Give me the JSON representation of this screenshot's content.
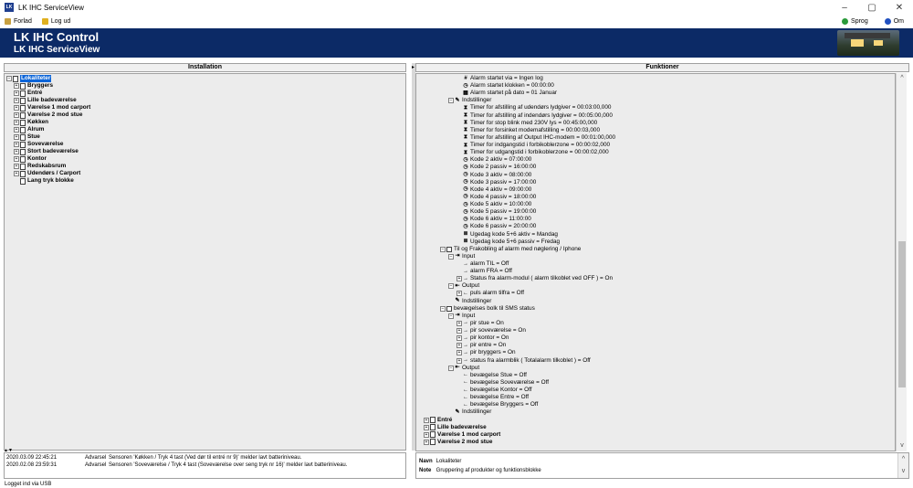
{
  "window": {
    "title": "LK IHC ServiceView",
    "logo_text": "LK",
    "minimize": "–",
    "maximize": "▢",
    "close": "✕"
  },
  "menu": {
    "leave": "Forlad",
    "logout": "Log ud",
    "language": "Sprog",
    "about": "Om"
  },
  "banner": {
    "title": "LK IHC Control",
    "subtitle": "LK IHC ServiceView"
  },
  "installation": {
    "header": "Installation",
    "items": [
      {
        "label": "Lokaliteter",
        "selected": true
      },
      {
        "label": "Bryggers"
      },
      {
        "label": "Entré"
      },
      {
        "label": "Lille badeværelse"
      },
      {
        "label": "Værelse 1 mod carport"
      },
      {
        "label": "Værelse 2 mod stue"
      },
      {
        "label": "Køkken"
      },
      {
        "label": "Alrum"
      },
      {
        "label": "Stue"
      },
      {
        "label": "Soveværelse"
      },
      {
        "label": "Stort badeværelse"
      },
      {
        "label": "Kontor"
      },
      {
        "label": "Redskabsrum"
      },
      {
        "label": "Udendørs / Carport"
      },
      {
        "label": "Lang tryk blokke"
      }
    ]
  },
  "functions": {
    "header": "Funktioner",
    "rows": [
      {
        "indent": 4,
        "icon": "hash",
        "label": "Alarm startet via = Ingen log"
      },
      {
        "indent": 4,
        "icon": "clock",
        "label": "Alarm startet klokken = 00:00:00"
      },
      {
        "indent": 4,
        "icon": "calendar",
        "label": "Alarm startet på dato = 01 Januar"
      },
      {
        "indent": 3,
        "exp": "−",
        "icon": "settings",
        "label": "Indstillinger"
      },
      {
        "indent": 4,
        "icon": "hourglass",
        "label": "Timer for afstilling af udendørs lydgiver = 00:03:00,000"
      },
      {
        "indent": 4,
        "icon": "hourglass",
        "label": "Timer for afstilling af indendørs lydgiver = 00:05:00,000"
      },
      {
        "indent": 4,
        "icon": "hourglass",
        "label": "Timer for stop blink med 230V lys = 00:45:00,000"
      },
      {
        "indent": 4,
        "icon": "hourglass",
        "label": "Timer for forsinket modemafstilling = 00:00:03,000"
      },
      {
        "indent": 4,
        "icon": "hourglass",
        "label": "Timer for afstilling af Output IHC-modem = 00:01:00,000"
      },
      {
        "indent": 4,
        "icon": "hourglass",
        "label": "Timer for indgangstid i forbikoblerzone = 00:00:02,000"
      },
      {
        "indent": 4,
        "icon": "hourglass",
        "label": "Timer for udgangstid i forbikoblerzone = 00:00:02,000"
      },
      {
        "indent": 4,
        "icon": "clock",
        "label": "Kode 2 aktiv = 07:00:00"
      },
      {
        "indent": 4,
        "icon": "clock",
        "label": "Kode 2 passiv = 16:00:00"
      },
      {
        "indent": 4,
        "icon": "clock",
        "label": "Kode 3 aktiv = 08:00:00"
      },
      {
        "indent": 4,
        "icon": "clock",
        "label": "Kode 3 passiv = 17:00:00"
      },
      {
        "indent": 4,
        "icon": "clock",
        "label": "Kode 4 aktiv = 09:00:00"
      },
      {
        "indent": 4,
        "icon": "clock",
        "label": "Kode 4 passiv = 18:00:00"
      },
      {
        "indent": 4,
        "icon": "clock",
        "label": "Kode 5 aktiv = 10:00:00"
      },
      {
        "indent": 4,
        "icon": "clock",
        "label": "Kode 5 passiv = 19:00:00"
      },
      {
        "indent": 4,
        "icon": "clock",
        "label": "Kode 6 aktiv = 11:00:00"
      },
      {
        "indent": 4,
        "icon": "clock",
        "label": "Kode 6 passiv = 20:00:00"
      },
      {
        "indent": 4,
        "icon": "weekday",
        "label": "Ugedag kode 5+6 aktiv = Mandag"
      },
      {
        "indent": 4,
        "icon": "weekday",
        "label": "Ugedag kode 5+6 passiv = Fredag"
      },
      {
        "indent": 2,
        "exp": "−",
        "icon": "block",
        "label": "Til og Frakobling af alarm med nøglering / Iphone"
      },
      {
        "indent": 3,
        "exp": "−",
        "icon": "input",
        "label": "Input"
      },
      {
        "indent": 4,
        "icon": "arrow-right",
        "label": "alarm TIL = Off"
      },
      {
        "indent": 4,
        "icon": "arrow-right",
        "label": "alarm FRA = Off"
      },
      {
        "indent": 4,
        "exp": "+",
        "icon": "arrow-right",
        "label": "Status fra alarm-modul ( alarm tilkoblet ved OFF ) = On"
      },
      {
        "indent": 3,
        "exp": "−",
        "icon": "output",
        "label": "Output"
      },
      {
        "indent": 4,
        "exp": "+",
        "icon": "arrow-left",
        "label": "puls alarm tilfra = Off"
      },
      {
        "indent": 3,
        "icon": "settings",
        "label": "Indstillinger"
      },
      {
        "indent": 2,
        "exp": "−",
        "icon": "block",
        "label": "bevægelses bolk til SMS status"
      },
      {
        "indent": 3,
        "exp": "−",
        "icon": "input",
        "label": "Input"
      },
      {
        "indent": 4,
        "exp": "+",
        "icon": "arrow-right",
        "label": "pir stue = On"
      },
      {
        "indent": 4,
        "exp": "+",
        "icon": "arrow-right",
        "label": "pir soveværelse = On"
      },
      {
        "indent": 4,
        "exp": "+",
        "icon": "arrow-right",
        "label": "pir kontor = On"
      },
      {
        "indent": 4,
        "exp": "+",
        "icon": "arrow-right",
        "label": "pir entre = On"
      },
      {
        "indent": 4,
        "exp": "+",
        "icon": "arrow-right",
        "label": "pir bryggers = On"
      },
      {
        "indent": 4,
        "exp": "+",
        "icon": "arrow-right",
        "label": "status fra alarmblik ( Totalalarm tilkoblet ) = Off"
      },
      {
        "indent": 3,
        "exp": "−",
        "icon": "output",
        "label": "Output"
      },
      {
        "indent": 4,
        "icon": "arrow-left",
        "label": "bevægelse  Stue = Off"
      },
      {
        "indent": 4,
        "icon": "arrow-left",
        "label": "bevægelse  Soveværelse = Off"
      },
      {
        "indent": 4,
        "icon": "arrow-left",
        "label": "bevægelse  Kontor = Off"
      },
      {
        "indent": 4,
        "icon": "arrow-left",
        "label": "bevægelse  Entre = Off"
      },
      {
        "indent": 4,
        "icon": "arrow-left",
        "label": "bevægelse  Bryggers = Off"
      },
      {
        "indent": 3,
        "icon": "settings",
        "label": "Indstillinger"
      },
      {
        "indent": 0,
        "exp": "+",
        "icon": "doc",
        "label": "Entré",
        "bold": true
      },
      {
        "indent": 0,
        "exp": "+",
        "icon": "doc",
        "label": "Lille badeværelse",
        "bold": true
      },
      {
        "indent": 0,
        "exp": "+",
        "icon": "doc",
        "label": "Værelse 1 mod carport",
        "bold": true
      },
      {
        "indent": 0,
        "exp": "+",
        "icon": "doc",
        "label": "Værelse 2 mod stue",
        "bold": true
      }
    ]
  },
  "log": {
    "sort_indicator": "▲▼",
    "entries": [
      {
        "time": "2020.03.09 22:45:21",
        "level": "Advarsel",
        "message": "Sensoren 'Køkken / Tryk 4 tast (Ved dør til entré nr 9)' melder lavt batteriniveau."
      },
      {
        "time": "2020.02.08 23:59:31",
        "level": "Advarsel",
        "message": "Sensoren 'Soveværelse / Tryk 4 tast (Soveværelse over seng tryk nr 16)' melder lavt batteriniveau."
      }
    ]
  },
  "info": {
    "name_label": "Navn",
    "name_value": "Lokaliteter",
    "note_label": "Note",
    "note_value": "Gruppering af produkter og funktionsblokke"
  },
  "status": {
    "text": "Logget ind via USB"
  },
  "icons": {
    "hash": "#",
    "clock": "◷",
    "calendar": "▦",
    "settings": "✎",
    "hourglass": "⧗",
    "weekday": "≣",
    "block": "▭",
    "input": "⇥",
    "output": "⇤",
    "arrow-right": "→",
    "arrow-left": "←",
    "doc": ""
  },
  "colors": {
    "banner": "#0c2a66",
    "selection": "#0a64d8",
    "panel": "#ececec"
  }
}
